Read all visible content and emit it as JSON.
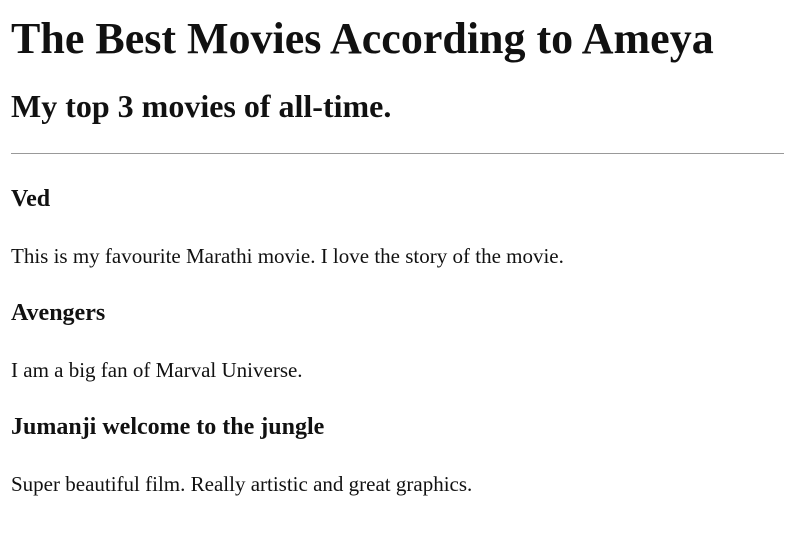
{
  "page": {
    "title": "The Best Movies According to Ameya",
    "subtitle": "My top 3 movies of all-time."
  },
  "movies": [
    {
      "title": "Ved",
      "description": "This is my favourite Marathi movie. I love the story of the movie."
    },
    {
      "title": "Avengers",
      "description": "I am a big fan of Marval Universe."
    },
    {
      "title": "Jumanji welcome to the jungle",
      "description": "Super beautiful film. Really artistic and great graphics."
    }
  ]
}
